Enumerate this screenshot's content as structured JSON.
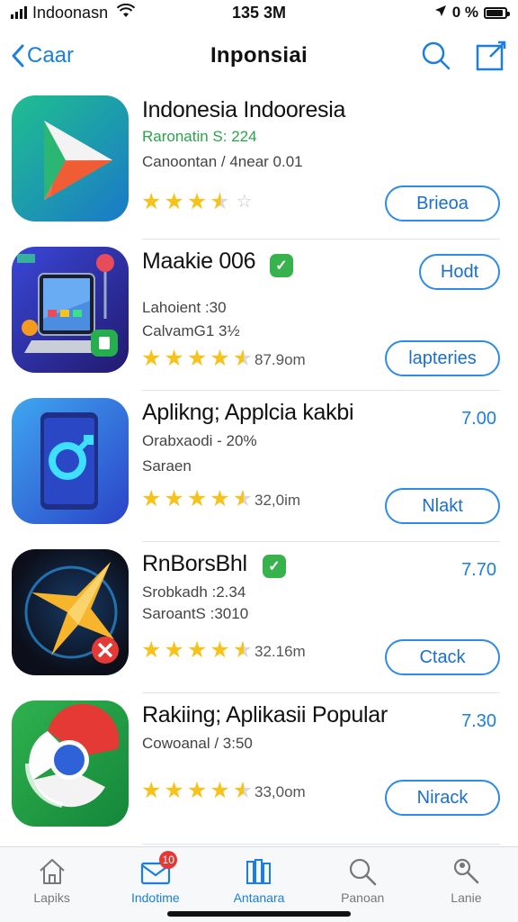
{
  "status_bar": {
    "carrier": "Indoonasn",
    "time": "135 3M",
    "battery_text": "0 %",
    "battery_level": 0.9
  },
  "nav": {
    "back_label": "Caar",
    "title": "Inponsiai",
    "icons": [
      "search-icon",
      "edit-icon"
    ]
  },
  "apps": [
    {
      "title": "Indonesia Indooresia",
      "meta1": "Raronatin S: 224",
      "meta2": "Canoontan / 4near 0.01",
      "rating": 3.5,
      "size": "",
      "price": "",
      "button": "Brieoa"
    },
    {
      "title": "Maakie 006",
      "meta1": "Lahoient      :30",
      "meta2": "CalvamG1  3½",
      "rating": 4.5,
      "size": "87.9om",
      "price": "",
      "small_button": "Hodt",
      "button": "lapteries"
    },
    {
      "title": "Aplikng; Applcia kakbi",
      "meta1": "Orabxaodi - 20%",
      "meta2": "Saraen",
      "rating": 4.5,
      "size": "32,0im",
      "price": "7.00",
      "button": "Nlakt"
    },
    {
      "title": "RnBorsBhl",
      "meta1": "Srobkadh :2.34",
      "meta2": "SaroantS :3010",
      "rating": 4.5,
      "size": "32.16m",
      "price": "7.70",
      "button": "Ctack"
    },
    {
      "title": "Rakiing; Aplikasii Popular",
      "meta1": "Cowoanal / 3:50",
      "meta2": "",
      "rating": 4.5,
      "size": "33,0om",
      "price": "7.30",
      "button": "Nirack"
    }
  ],
  "tabs": [
    {
      "label": "Lapiks",
      "icon": "home-icon"
    },
    {
      "label": "Indotime",
      "icon": "mail-icon",
      "badge": "10"
    },
    {
      "label": "Antanara",
      "icon": "library-icon"
    },
    {
      "label": "Panoan",
      "icon": "search-icon"
    },
    {
      "label": "Lanie",
      "icon": "search-person-icon"
    }
  ],
  "colors": {
    "accent": "#1a7fe0",
    "star": "#f7c21a",
    "green": "#2ba34a"
  }
}
